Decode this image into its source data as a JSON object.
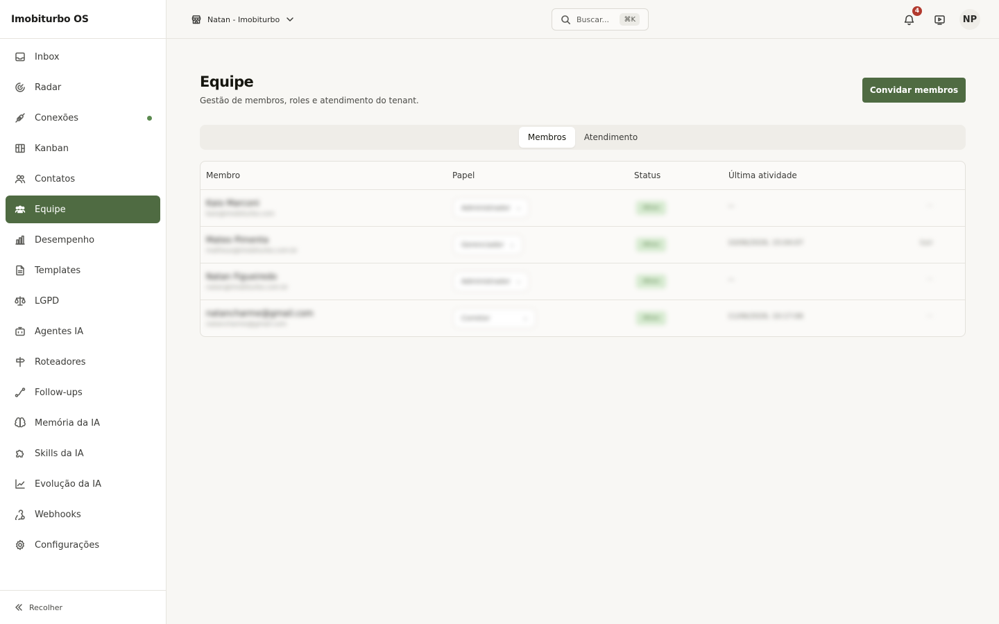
{
  "app": {
    "title": "Imobiturbo OS"
  },
  "sidebar": {
    "items": [
      {
        "label": "Inbox",
        "icon": "inbox-icon"
      },
      {
        "label": "Radar",
        "icon": "radar-icon"
      },
      {
        "label": "Conexões",
        "icon": "plug-icon",
        "status": "connected"
      },
      {
        "label": "Kanban",
        "icon": "kanban-icon"
      },
      {
        "label": "Contatos",
        "icon": "contacts-icon"
      },
      {
        "label": "Equipe",
        "icon": "team-icon",
        "active": true
      },
      {
        "label": "Desempenho",
        "icon": "bar-chart-icon"
      },
      {
        "label": "Templates",
        "icon": "file-text-icon"
      },
      {
        "label": "LGPD",
        "icon": "scale-icon"
      },
      {
        "label": "Agentes IA",
        "icon": "bot-icon"
      },
      {
        "label": "Roteadores",
        "icon": "signpost-icon"
      },
      {
        "label": "Follow-ups",
        "icon": "route-icon"
      },
      {
        "label": "Memória da IA",
        "icon": "brain-icon"
      },
      {
        "label": "Skills da IA",
        "icon": "puzzle-icon"
      },
      {
        "label": "Evolução da IA",
        "icon": "trend-icon"
      },
      {
        "label": "Webhooks",
        "icon": "webhook-icon"
      },
      {
        "label": "Configurações",
        "icon": "gear-icon"
      }
    ],
    "collapse_label": "Recolher"
  },
  "header": {
    "workspace": "Natan - Imobiturbo",
    "search_placeholder": "Buscar...",
    "search_shortcut": "⌘K",
    "notification_count": "4",
    "avatar_initials": "NP"
  },
  "page": {
    "title": "Equipe",
    "subtitle": "Gestão de membros, roles e atendimento do tenant.",
    "invite_label": "Convidar membros",
    "tabs": [
      {
        "label": "Membros",
        "active": true
      },
      {
        "label": "Atendimento",
        "active": false
      }
    ],
    "table": {
      "columns": [
        "Membro",
        "Papel",
        "Status",
        "Última atividade"
      ],
      "rows": [
        {
          "name": "Kaio Marconi",
          "email": "kaio@imobiturbo.com",
          "role": "Administrador",
          "status": "Ativo",
          "last": "—",
          "action": "···"
        },
        {
          "name": "Mateo Pimenta",
          "email": "matheus@imobiturbo.com.br",
          "role": "Gerenciador",
          "status": "Ativo",
          "last": "10/06/2026, 15:04:07",
          "action": "Sair"
        },
        {
          "name": "Natan Figueiredo",
          "email": "natan@imobiturbo.com.br",
          "role": "Administrador",
          "status": "Ativo",
          "last": "—",
          "action": "···"
        },
        {
          "name": "natancharme@gmail.com",
          "email": "natancharme@gmail.com",
          "role": "Corretor",
          "status": "Ativo",
          "last": "11/06/2026, 10:17:06",
          "action": "···"
        }
      ]
    }
  },
  "colors": {
    "accent": "#4f6b42",
    "badge": "#b23a2e",
    "status_active_bg": "#d6ead0"
  }
}
